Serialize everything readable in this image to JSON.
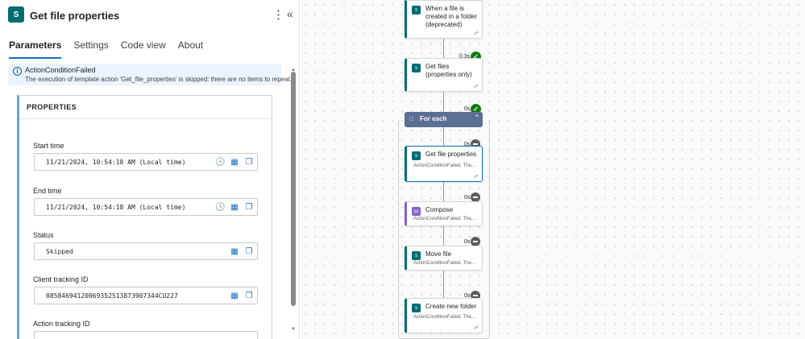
{
  "panel": {
    "title": "Get file properties",
    "app_icon_text": "S",
    "more_icon": "⋮",
    "collapse_icon": "«",
    "tabs": [
      {
        "label": "Parameters"
      },
      {
        "label": "Settings"
      },
      {
        "label": "Code view"
      },
      {
        "label": "About"
      }
    ],
    "banner": {
      "title": "ActionConditionFailed",
      "message": "The execution of template action 'Get_file_properties' is skipped: there are no items to repeat."
    },
    "properties": {
      "heading": "PROPERTIES",
      "fields": [
        {
          "label": "Start time",
          "value": "11/21/2024, 10:54:18 AM (Local time)"
        },
        {
          "label": "End time",
          "value": "11/21/2024, 10:54:18 AM (Local time)"
        },
        {
          "label": "Status",
          "value": "Skipped"
        },
        {
          "label": "Client tracking ID",
          "value": "08584694120069352513873907344CU227"
        },
        {
          "label": "Action tracking ID",
          "value": ""
        }
      ]
    }
  },
  "canvas": {
    "nodes": [
      {
        "title": "When a file is created in a folder (deprecated)",
        "sub": ""
      },
      {
        "title": "Get files (properties only)",
        "sub": "",
        "duration": "0.3s"
      },
      {
        "title": "For each",
        "duration": "0s"
      },
      {
        "title": "Get file properties",
        "sub": "ActionConditionFailed. The...",
        "duration": "0s"
      },
      {
        "title": "Compose",
        "sub": "ActionConditionFailed. The...",
        "duration": "0s"
      },
      {
        "title": "Move file",
        "sub": "ActionConditionFailed. The...",
        "duration": "0s"
      },
      {
        "title": "Create new folder",
        "sub": "ActionConditionFailed. The...",
        "duration": "0s"
      }
    ]
  },
  "colors": {
    "accent": "#0f6cbd",
    "sharepoint": "#036c70",
    "success": "#107c10",
    "skipped": "#5c5c5c",
    "foreach_header": "#5b6f95",
    "compose": "#8661c5"
  }
}
